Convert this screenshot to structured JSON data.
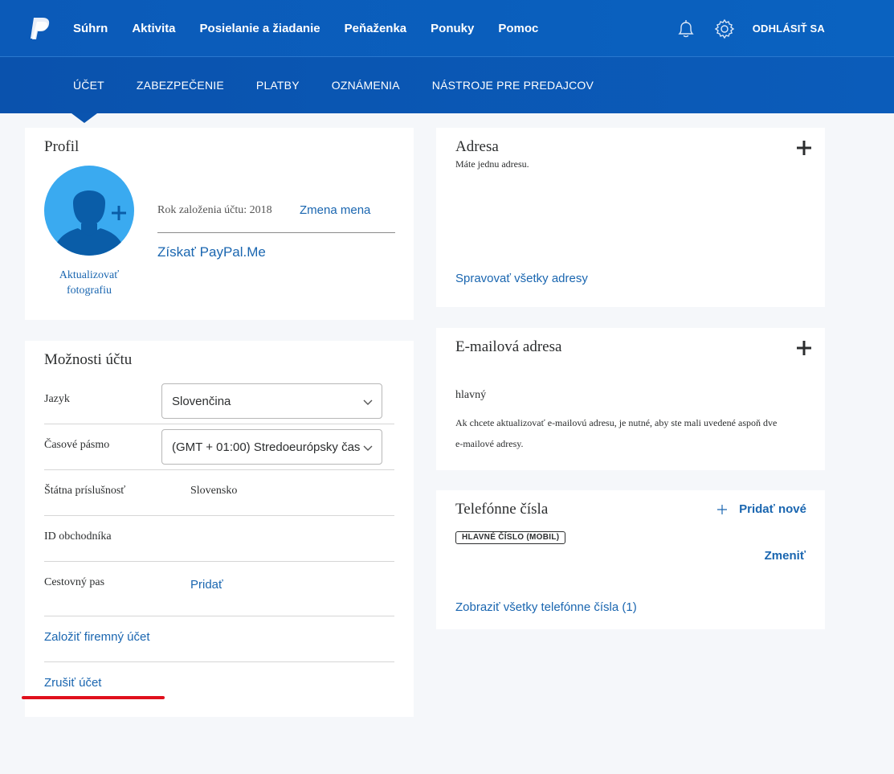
{
  "header": {
    "nav": [
      "Súhrn",
      "Aktivita",
      "Posielanie a žiadanie",
      "Peňaženka",
      "Ponuky",
      "Pomoc"
    ],
    "logout": "ODHLÁSIŤ SA"
  },
  "subnav": [
    "ÚČET",
    "ZABEZPEČENIE",
    "PLATBY",
    "OZNÁMENIA",
    "NÁSTROJE PRE PREDAJCOV"
  ],
  "profile": {
    "title": "Profil",
    "update_photo_line1": "Aktualizovať",
    "update_photo_line2": "fotografiu",
    "account_year": "Rok založenia účtu: 2018",
    "change_name": "Zmena mena",
    "paypal_me": "Získať PayPal.Me"
  },
  "options": {
    "title": "Možnosti účtu",
    "language_label": "Jazyk",
    "language_value": "Slovenčina",
    "timezone_label": "Časové pásmo",
    "timezone_value": "(GMT + 01:00) Stredoeurópsky čas",
    "citizenship_label": "Štátna príslušnosť",
    "citizenship_value": "Slovensko",
    "merchant_id_label": "ID obchodníka",
    "passport_label": "Cestovný pas",
    "passport_action": "Pridať",
    "business_account": "Založiť firemný účet",
    "close_account": "Zrušiť účet"
  },
  "address": {
    "title": "Adresa",
    "subtitle": "Máte jednu adresu.",
    "manage": "Spravovať všetky adresy"
  },
  "email": {
    "title": "E-mailová adresa",
    "primary": "hlavný",
    "note_line1": "Ak chcete aktualizovať e-mailovú adresu, je nutné, aby ste mali uvedené aspoň dve",
    "note_line2": "e-mailové adresy."
  },
  "phones": {
    "title": "Telefónne čísla",
    "add_new": "Pridať nové",
    "badge": "HLAVNÉ ČÍSLO (MOBIL)",
    "change": "Zmeniť",
    "view_all": "Zobraziť všetky telefónne čísla (1)"
  },
  "colors": {
    "topbar": "#0b5ab8",
    "link": "#1a66b0",
    "highlight": "#e0101c"
  }
}
